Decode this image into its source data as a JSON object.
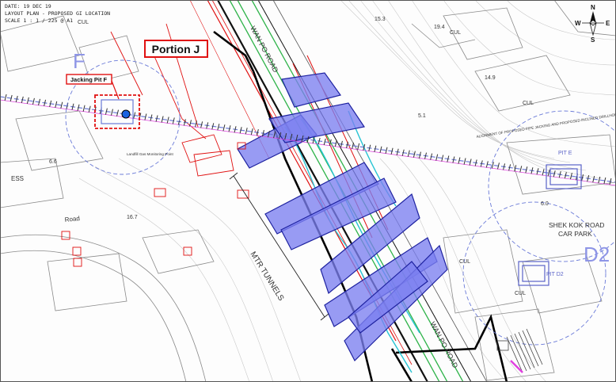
{
  "header": {
    "date": "DATE: 19 DEC 19",
    "plan": "LAYOUT PLAN - PROPOSED GI LOCATION",
    "scale": "SCALE 1 : 1 / 225 @ A1"
  },
  "callouts": {
    "portion": "Portion J",
    "jacking_pit": "Jacking Pit F"
  },
  "map_labels": {
    "road_top": "WAN PO ROAD",
    "road_bottom": "WAN PO ROAD",
    "tunnels": "MTR TUNNELS",
    "car_park_line1": "SHEK KOK ROAD",
    "car_park_line2": "CAR PARK",
    "ess": "ESS",
    "pit_e": "PIT E",
    "pit_d2": "PIT D2",
    "zone_f": "F",
    "zone_d2": "D2",
    "cul_1": "CUL",
    "cul_2": "CUL",
    "cul_3": "CUL",
    "cul_4": "CUL",
    "cul_5": "CUL",
    "elev_1": "6.6",
    "elev_2": "16.7",
    "elev_3": "15.3",
    "elev_4": "19.4",
    "elev_5": "14.9",
    "elev_6": "6.0",
    "elev_7": "5.1",
    "road_small": "Road",
    "alignment_note": "ALIGNMENT OF PROPOSED PIPE JACKING AND PROPOSED INCLINED DRILLHOLE",
    "landfill_note": "Landfill Gas Monitoring Point"
  },
  "compass": {
    "n": "N",
    "s": "S",
    "e": "E",
    "w": "W"
  },
  "colors": {
    "zone_fill": "#7b7ff0",
    "zone_stroke": "#1e22a0",
    "callout_red": "#e01010",
    "road_green": "#2fb34a",
    "tunnel_cyan": "#27c4d4",
    "pipe_magenta": "#e040e0",
    "dash_blue": "#6a7ad8"
  }
}
